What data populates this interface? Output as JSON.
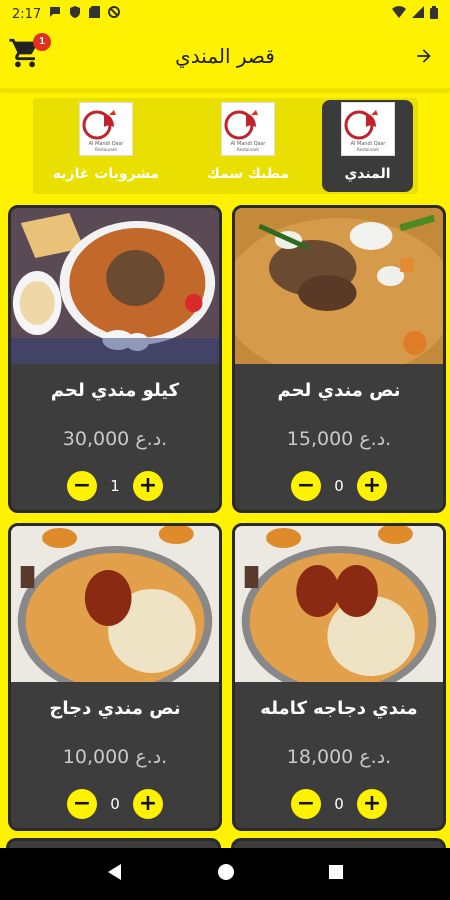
{
  "status_bar": {
    "time": "2:17"
  },
  "app_bar": {
    "title": "قصر المندي",
    "cart_count": "1"
  },
  "categories": [
    {
      "label": "المندي",
      "active": true
    },
    {
      "label": "مطبك سمك",
      "active": false
    },
    {
      "label": "مشروبات غازيه",
      "active": false
    }
  ],
  "logo_text": "Al Mandi Qasr Restaurant",
  "products": [
    {
      "name": "نص مندي لحم",
      "price": "15,000 د.ع.",
      "qty": "0",
      "image": "lamb-mandi"
    },
    {
      "name": "كيلو مندي لحم",
      "price": "30,000 د.ع.",
      "qty": "1",
      "image": "kilo-lamb-mandi"
    },
    {
      "name": "مندي دجاجه كامله",
      "price": "18,000 د.ع.",
      "qty": "0",
      "image": "whole-chicken-mandi"
    },
    {
      "name": "نص مندي دجاج",
      "price": "10,000 د.ع.",
      "qty": "0",
      "image": "half-chicken-mandi"
    }
  ],
  "colors": {
    "accent": "#fff200",
    "card": "#3d3d3d",
    "badge": "#e0301e"
  }
}
